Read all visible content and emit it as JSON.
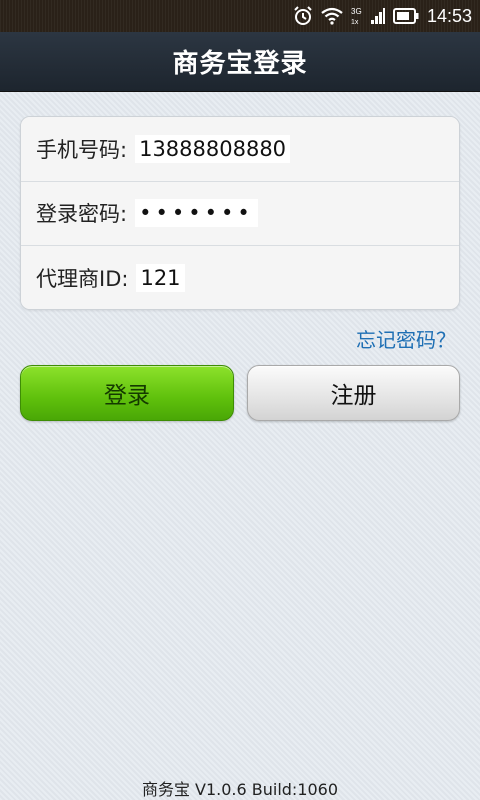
{
  "status_bar": {
    "time": "14:53",
    "network_label": "3G",
    "icons": [
      "alarm-icon",
      "wifi-icon",
      "signal-icon",
      "battery-icon"
    ]
  },
  "header": {
    "title": "商务宝登录"
  },
  "form": {
    "phone_label": "手机号码:",
    "phone_value": "13888808880",
    "password_label": "登录密码:",
    "password_value": "•••••••",
    "agent_label": "代理商ID:",
    "agent_value": "121"
  },
  "links": {
    "forgot_password": "忘记密码？"
  },
  "buttons": {
    "login": "登录",
    "register": "注册"
  },
  "footer": {
    "version": "商务宝 V1.0.6 Build:1060"
  },
  "colors": {
    "title_bar": "#1d252e",
    "login_button": "#5fc00c",
    "link": "#1e6fb4",
    "background": "#e3e9ef"
  }
}
